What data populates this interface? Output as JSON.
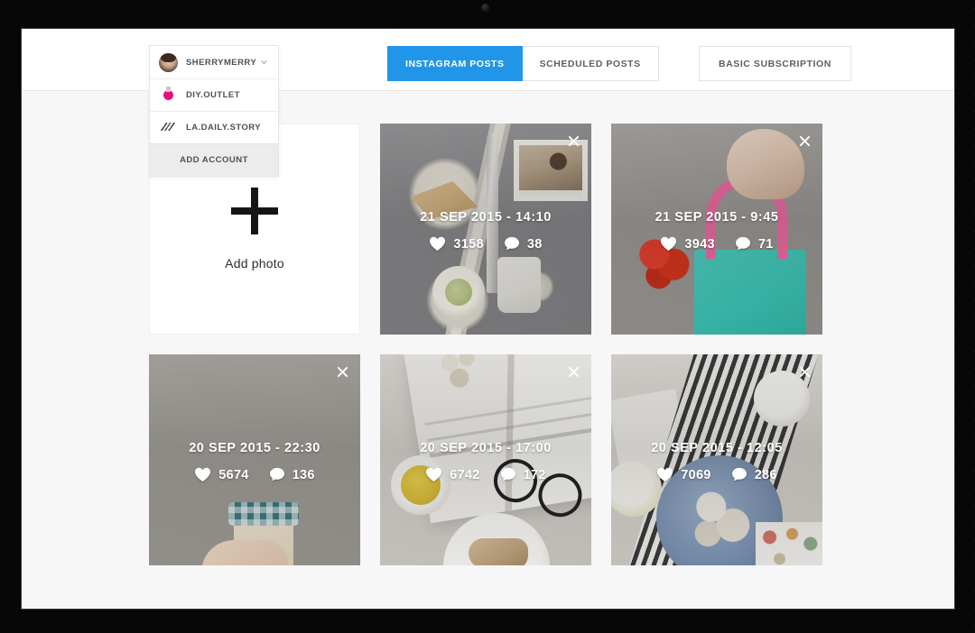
{
  "header": {
    "tabs": [
      {
        "label": "INSTAGRAM POSTS",
        "active": true
      },
      {
        "label": "SCHEDULED POSTS",
        "active": false
      }
    ],
    "subscription_label": "BASIC SUBSCRIPTION"
  },
  "account_dropdown": {
    "selected": "SHERRYMERRY",
    "caret_icon": "chevron-down-icon",
    "accounts": [
      {
        "name": "SHERRYMERRY",
        "avatar": "avatar-sherrymerry"
      },
      {
        "name": "DIY.OUTLET",
        "avatar": "avatar-diy-outlet"
      },
      {
        "name": "LA.DAILY.STORY",
        "avatar": "avatar-la-daily-story"
      }
    ],
    "add_account_label": "ADD ACCOUNT"
  },
  "add_photo_card": {
    "label": "Add photo",
    "plus_icon": "plus-icon"
  },
  "posts": [
    {
      "date": "21 SEP 2015 - 14:10",
      "likes": "3158",
      "comments": "38",
      "photo": "breakfast-toast-knife",
      "close_icon": "close-icon"
    },
    {
      "date": "21 SEP 2015 - 9:45",
      "likes": "3943",
      "comments": "71",
      "photo": "teal-tote-bag-hand",
      "close_icon": "close-icon"
    },
    {
      "date": "20 SEP 2015 - 22:30",
      "likes": "5674",
      "comments": "136",
      "photo": "hand-holding-jam-jar",
      "close_icon": "close-icon"
    },
    {
      "date": "20 SEP 2015 - 17:00",
      "likes": "6742",
      "comments": "172",
      "photo": "open-book-glasses-tea",
      "close_icon": "close-icon"
    },
    {
      "date": "20 SEP 2015 - 12:05",
      "likes": "7069",
      "comments": "286",
      "photo": "striped-cloth-flatlay",
      "close_icon": "close-icon"
    }
  ],
  "colors": {
    "accent": "#2196e8",
    "page_background": "#f7f7f7",
    "header_background": "#ffffff",
    "text": "#4c5056",
    "bezel": "#070707"
  }
}
